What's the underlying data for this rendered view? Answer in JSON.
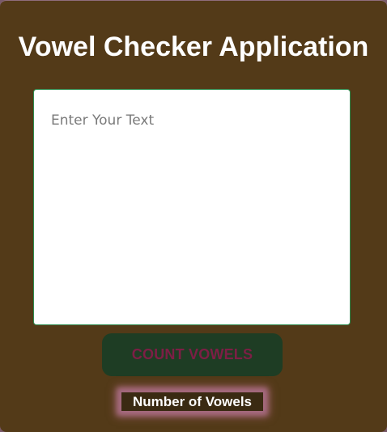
{
  "app": {
    "title": "Vowel Checker Application"
  },
  "input": {
    "placeholder": "Enter Your Text",
    "value": ""
  },
  "button": {
    "label": "COUNT VOWELS"
  },
  "result": {
    "label": "Number of Vowels"
  },
  "colors": {
    "card_background": "#533a18",
    "button_background": "#1e3d24",
    "button_text": "#7d1e45",
    "input_border": "#2e8b4e",
    "result_glow": "#a56a80"
  }
}
